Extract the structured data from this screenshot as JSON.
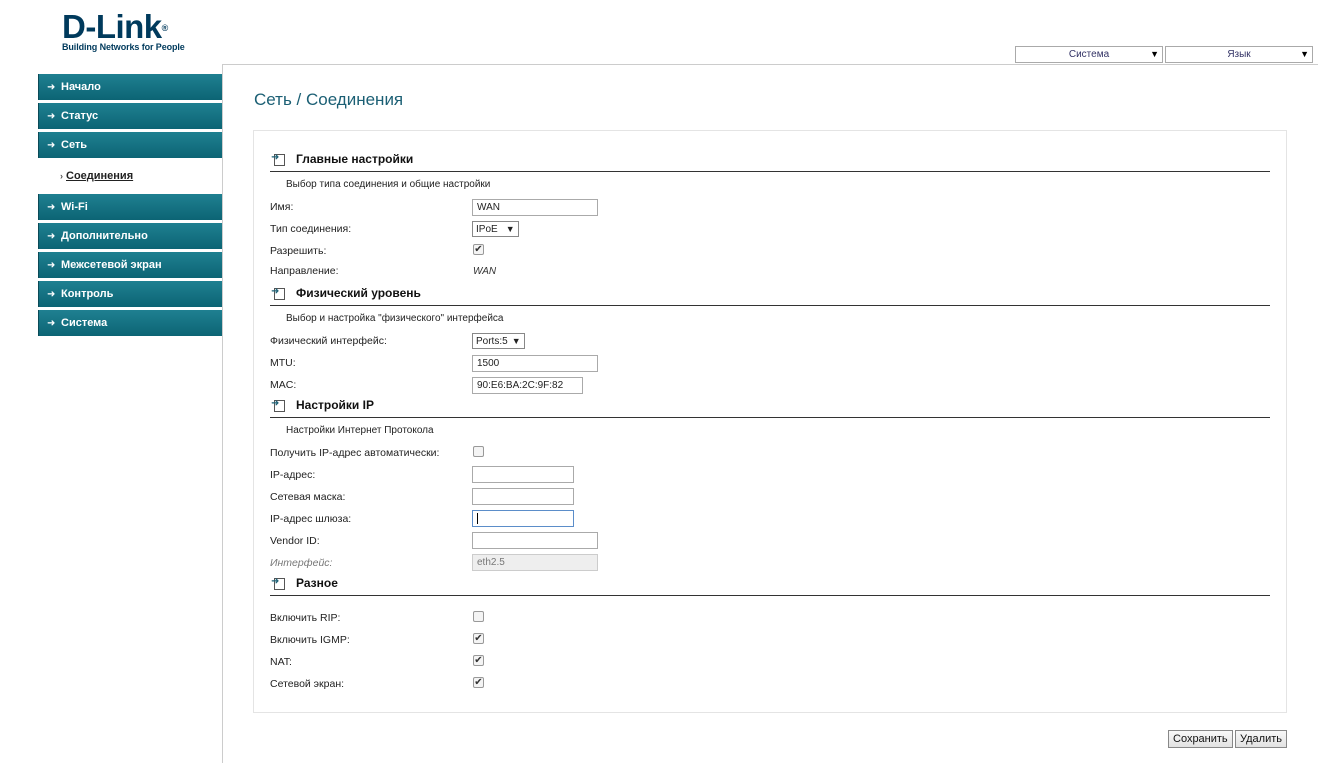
{
  "header": {
    "logo_main": "D-Link",
    "logo_reg": "®",
    "logo_tagline": "Building Networks for People",
    "system_select": "Система",
    "language_select": "Язык"
  },
  "sidebar": {
    "items": [
      {
        "label": "Начало"
      },
      {
        "label": "Статус"
      },
      {
        "label": "Сеть"
      },
      {
        "label": "Wi-Fi"
      },
      {
        "label": "Дополнительно"
      },
      {
        "label": "Межсетевой экран"
      },
      {
        "label": "Контроль"
      },
      {
        "label": "Система"
      }
    ],
    "active_sub": "Соединения"
  },
  "page": {
    "title": "Сеть  / Соединения"
  },
  "main_settings": {
    "title": "Главные настройки",
    "desc": "Выбор типа соединения и общие настройки",
    "name_label": "Имя:",
    "name_value": "WAN",
    "type_label": "Тип соединения:",
    "type_value": "IPoE",
    "enable_label": "Разрешить:",
    "enable_checked": true,
    "direction_label": "Направление:",
    "direction_value": "WAN"
  },
  "physical": {
    "title": "Физический уровень",
    "desc": "Выбор и настройка \"физического\" интерфейса",
    "iface_label": "Физический интерфейс:",
    "iface_value": "Ports:5",
    "mtu_label": "MTU:",
    "mtu_value": "1500",
    "mac_label": "MAC:",
    "mac_value": "90:E6:BA:2C:9F:82"
  },
  "ip": {
    "title": "Настройки IP",
    "desc": "Настройки Интернет Протокола",
    "auto_label": "Получить IP-адрес автоматически:",
    "auto_checked": false,
    "ip_label": "IP-адрес:",
    "mask_label": "Сетевая маска:",
    "gw_label": "IP-адрес шлюза:",
    "vendor_label": "Vendor ID:",
    "iface_label": "Интерфейс:",
    "iface_value": "eth2.5"
  },
  "misc": {
    "title": "Разное",
    "rip_label": "Включить RIP:",
    "rip_checked": false,
    "igmp_label": "Включить IGMP:",
    "igmp_checked": true,
    "nat_label": "NAT:",
    "nat_checked": true,
    "fw_label": "Сетевой экран:",
    "fw_checked": true
  },
  "buttons": {
    "save": "Сохранить",
    "delete": "Удалить"
  },
  "colors": {
    "menu_bg": "#0c6474",
    "title": "#1b5f74"
  }
}
